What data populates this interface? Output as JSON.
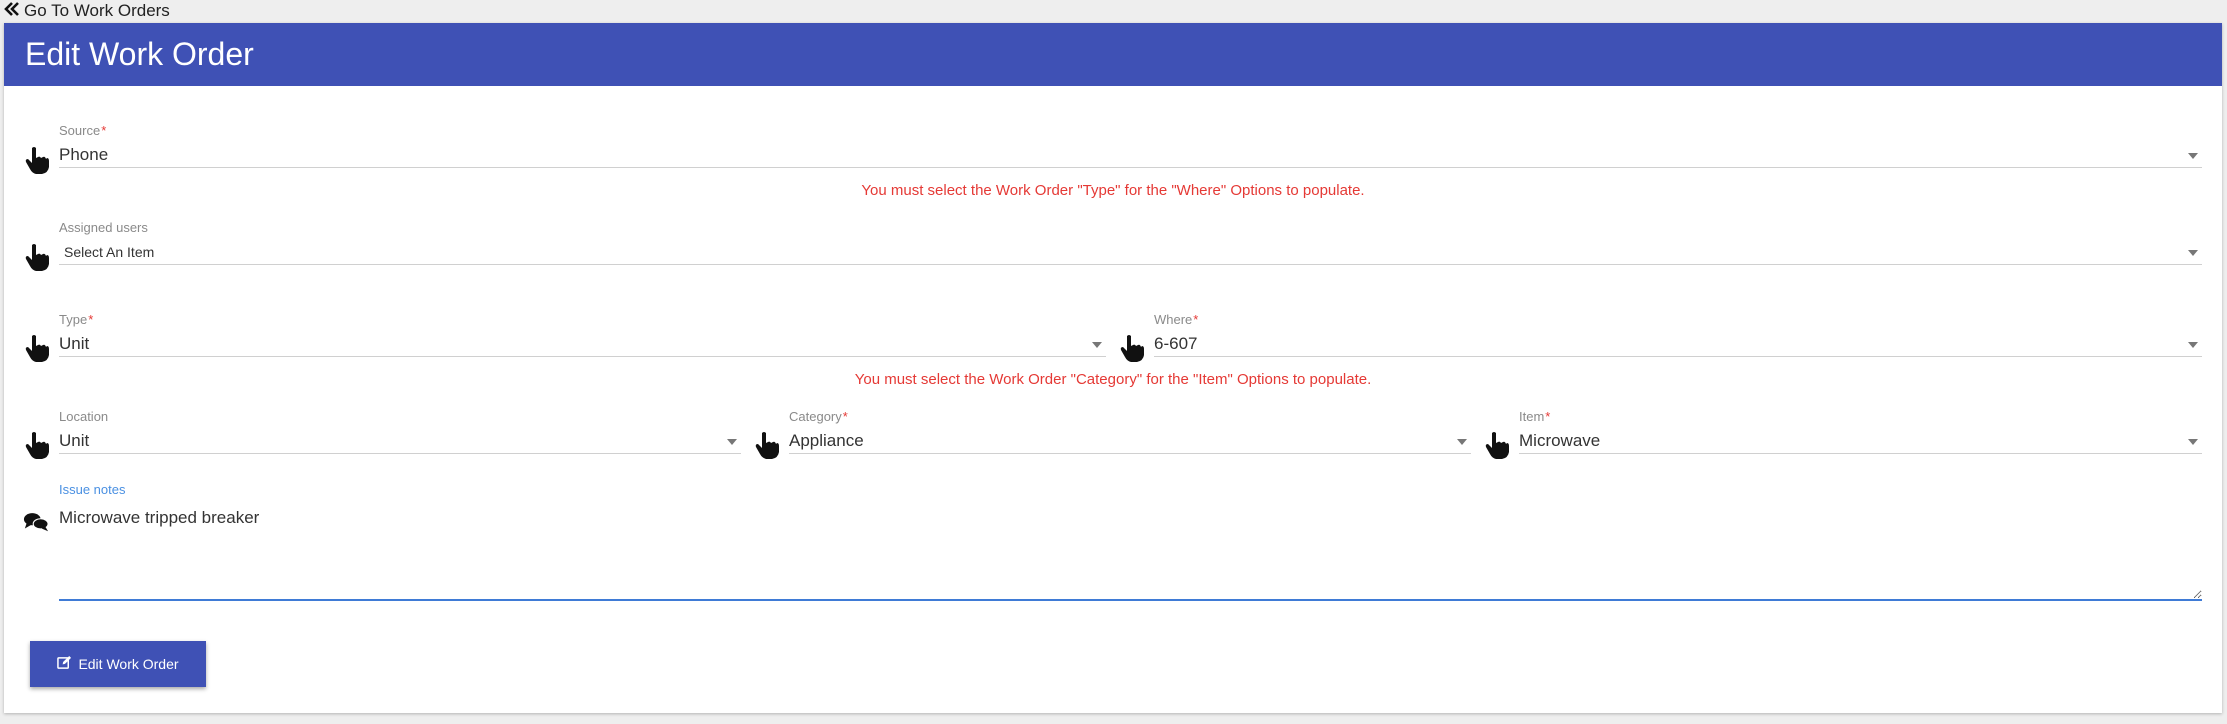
{
  "nav": {
    "back_label": "Go To Work Orders",
    "back_icon": "double-chevron-left-icon"
  },
  "header": {
    "title": "Edit Work Order"
  },
  "colors": {
    "primary": "#3f51b5",
    "error": "#e53935",
    "focus": "#3f7bd6"
  },
  "form": {
    "source": {
      "label": "Source",
      "required": "*",
      "value": "Phone",
      "icon": "hand-pointer-icon"
    },
    "where_error": "You must select the Work Order \"Type\" for the \"Where\" Options to populate.",
    "assigned_users": {
      "label": "Assigned users",
      "placeholder": "Select An Item",
      "icon": "hand-pointer-icon"
    },
    "type": {
      "label": "Type",
      "required": "*",
      "value": "Unit",
      "icon": "hand-pointer-icon"
    },
    "where": {
      "label": "Where",
      "required": "*",
      "value": "6-607",
      "icon": "hand-pointer-icon"
    },
    "item_error": "You must select the Work Order \"Category\" for the \"Item\" Options to populate.",
    "location": {
      "label": "Location",
      "value": "Unit",
      "icon": "hand-pointer-icon"
    },
    "category": {
      "label": "Category",
      "required": "*",
      "value": "Appliance",
      "icon": "hand-pointer-icon"
    },
    "item": {
      "label": "Item",
      "required": "*",
      "value": "Microwave",
      "icon": "hand-pointer-icon"
    },
    "issue_notes": {
      "label": "Issue notes",
      "value": "Microwave tripped breaker",
      "icon": "comments-icon"
    },
    "submit_label": "Edit Work Order",
    "submit_icon": "edit-icon"
  }
}
